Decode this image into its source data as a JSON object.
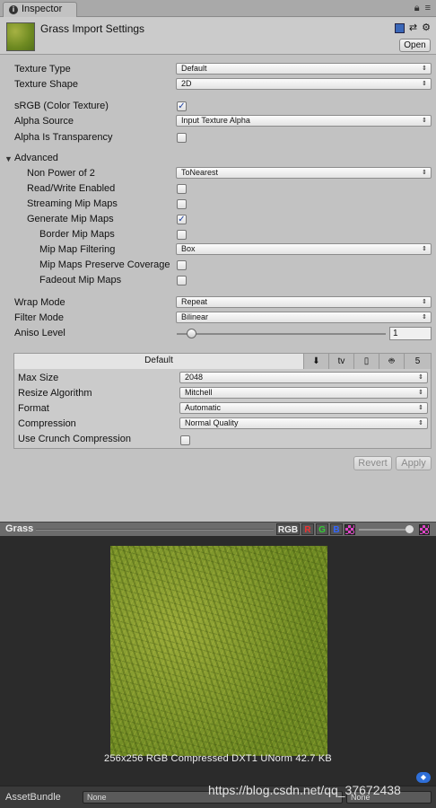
{
  "tab": {
    "label": "Inspector"
  },
  "header": {
    "title": "Grass Import Settings",
    "open_label": "Open"
  },
  "settings": {
    "texture_type": {
      "label": "Texture Type",
      "value": "Default"
    },
    "texture_shape": {
      "label": "Texture Shape",
      "value": "2D"
    },
    "srgb": {
      "label": "sRGB (Color Texture)",
      "checked": true
    },
    "alpha_source": {
      "label": "Alpha Source",
      "value": "Input Texture Alpha"
    },
    "alpha_transparency": {
      "label": "Alpha Is Transparency",
      "checked": false
    }
  },
  "advanced": {
    "label": "Advanced",
    "non_power_of_2": {
      "label": "Non Power of 2",
      "value": "ToNearest"
    },
    "read_write": {
      "label": "Read/Write Enabled",
      "checked": false
    },
    "streaming_mip": {
      "label": "Streaming Mip Maps",
      "checked": false
    },
    "generate_mip": {
      "label": "Generate Mip Maps",
      "checked": true
    },
    "border_mip": {
      "label": "Border Mip Maps",
      "checked": false
    },
    "mip_filtering": {
      "label": "Mip Map Filtering",
      "value": "Box"
    },
    "preserve_coverage": {
      "label": "Mip Maps Preserve Coverage",
      "checked": false
    },
    "fadeout_mip": {
      "label": "Fadeout Mip Maps",
      "checked": false
    }
  },
  "wrap": {
    "wrap_mode": {
      "label": "Wrap Mode",
      "value": "Repeat"
    },
    "filter_mode": {
      "label": "Filter Mode",
      "value": "Bilinear"
    },
    "aniso": {
      "label": "Aniso Level",
      "value": "1"
    }
  },
  "platform": {
    "default_tab": "Default",
    "icons": [
      "download-icon",
      "appletv-icon",
      "phone-icon",
      "android-icon",
      "html5-icon"
    ],
    "appletv_label": "tv",
    "max_size": {
      "label": "Max Size",
      "value": "2048"
    },
    "resize": {
      "label": "Resize Algorithm",
      "value": "Mitchell"
    },
    "format": {
      "label": "Format",
      "value": "Automatic"
    },
    "compression": {
      "label": "Compression",
      "value": "Normal Quality"
    },
    "crunch": {
      "label": "Use Crunch Compression",
      "checked": false
    }
  },
  "buttons": {
    "revert": "Revert",
    "apply": "Apply"
  },
  "preview": {
    "title": "Grass",
    "channels": [
      "RGB",
      "R",
      "G",
      "B"
    ],
    "info": "256x256  RGB Compressed DXT1 UNorm   42.7 KB"
  },
  "asset_bundle": {
    "label": "AssetBundle",
    "value": "None",
    "variant": "None"
  },
  "watermark": "https://blog.csdn.net/qq_37672438",
  "colors": {
    "red": "#e33",
    "green": "#3c3",
    "blue": "#36f",
    "accent": "#1a3d9e"
  }
}
